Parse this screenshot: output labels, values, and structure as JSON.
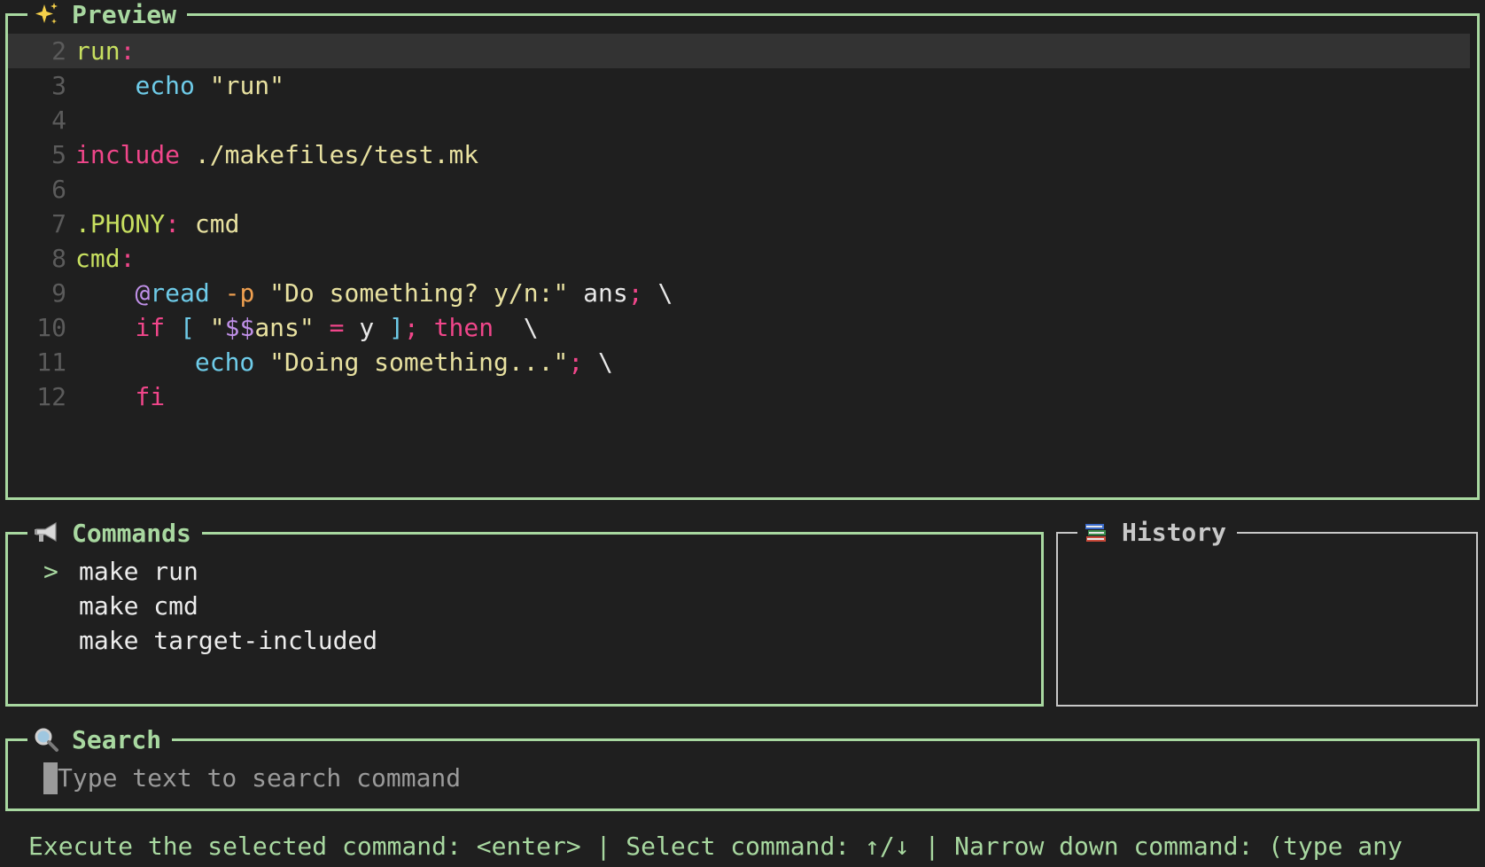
{
  "preview": {
    "title": "Preview",
    "icon": "sparkles-icon",
    "lines": [
      {
        "n": "2",
        "current": true,
        "tokens": [
          {
            "t": "run",
            "c": "target"
          },
          {
            "t": ":",
            "c": "colon"
          }
        ]
      },
      {
        "n": "3",
        "tokens": [
          {
            "t": "    ",
            "c": "plain"
          },
          {
            "t": "echo",
            "c": "echo"
          },
          {
            "t": " \"run\"",
            "c": "str"
          }
        ]
      },
      {
        "n": "4",
        "tokens": []
      },
      {
        "n": "5",
        "tokens": [
          {
            "t": "include",
            "c": "kw"
          },
          {
            "t": " ./makefiles/test.mk",
            "c": "str"
          }
        ]
      },
      {
        "n": "6",
        "tokens": []
      },
      {
        "n": "7",
        "tokens": [
          {
            "t": ".PHONY",
            "c": "target"
          },
          {
            "t": ":",
            "c": "colon"
          },
          {
            "t": " cmd",
            "c": "str"
          }
        ]
      },
      {
        "n": "8",
        "tokens": [
          {
            "t": "cmd",
            "c": "target"
          },
          {
            "t": ":",
            "c": "colon"
          }
        ]
      },
      {
        "n": "9",
        "tokens": [
          {
            "t": "    ",
            "c": "plain"
          },
          {
            "t": "@",
            "c": "at"
          },
          {
            "t": "read",
            "c": "echo"
          },
          {
            "t": " -p",
            "c": "flag"
          },
          {
            "t": " \"Do something? y/n:\"",
            "c": "str"
          },
          {
            "t": " ans",
            "c": "plain"
          },
          {
            "t": ";",
            "c": "kw"
          },
          {
            "t": " \\",
            "c": "plain"
          }
        ]
      },
      {
        "n": "10",
        "tokens": [
          {
            "t": "    ",
            "c": "plain"
          },
          {
            "t": "if",
            "c": "kw"
          },
          {
            "t": " [",
            "c": "echo"
          },
          {
            "t": " \"",
            "c": "str"
          },
          {
            "t": "$$",
            "c": "var"
          },
          {
            "t": "ans\"",
            "c": "str"
          },
          {
            "t": " =",
            "c": "kw"
          },
          {
            "t": " y",
            "c": "plain"
          },
          {
            "t": " ]",
            "c": "echo"
          },
          {
            "t": ";",
            "c": "kw"
          },
          {
            "t": " then",
            "c": "kw"
          },
          {
            "t": "  \\",
            "c": "plain"
          }
        ]
      },
      {
        "n": "11",
        "tokens": [
          {
            "t": "        ",
            "c": "plain"
          },
          {
            "t": "echo",
            "c": "echo"
          },
          {
            "t": " \"Doing something...\"",
            "c": "str"
          },
          {
            "t": ";",
            "c": "kw"
          },
          {
            "t": " \\",
            "c": "plain"
          }
        ]
      },
      {
        "n": "12",
        "tokens": [
          {
            "t": "    ",
            "c": "plain"
          },
          {
            "t": "fi",
            "c": "kw"
          }
        ]
      }
    ]
  },
  "commands": {
    "title": "Commands",
    "icon": "megaphone-icon",
    "caret": ">",
    "items": [
      {
        "label": "make run",
        "selected": true
      },
      {
        "label": "make cmd",
        "selected": false
      },
      {
        "label": "make target-included",
        "selected": false
      }
    ]
  },
  "history": {
    "title": "History",
    "icon": "books-icon"
  },
  "search": {
    "title": "Search",
    "icon": "magnifier-icon",
    "value": "",
    "placeholder": "Type text to search command"
  },
  "footer": {
    "text": "Execute the selected command: <enter> | Select command: ↑/↓ | Narrow down command: (type any"
  },
  "colors": {
    "active_border": "#a8d8a0",
    "inactive_border": "#c8c8c8",
    "background": "#1f1f1f"
  }
}
